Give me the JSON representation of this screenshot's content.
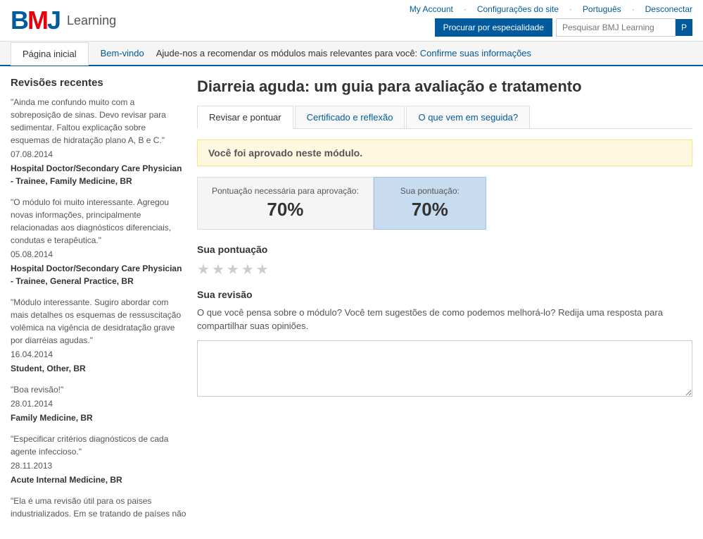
{
  "logo": {
    "bmj": "BMJ",
    "learning": "Learning"
  },
  "topnav": {
    "my_account": "My Account",
    "configuracoes": "Configurações do site",
    "portugues": "Português",
    "desconectar": "Desconectar",
    "search_placeholder": "Pesquisar BMJ Learning",
    "search_button": "P",
    "specialty_button": "Procurar por especialidade"
  },
  "tabs": {
    "home": "Página inicial",
    "welcome_prefix": "Bem-vindo",
    "welcome_message": "Ajude-nos a recomendar os módulos mais relevantes para você:",
    "confirm_link": "Confirme suas informações"
  },
  "sidebar": {
    "title": "Revisões recentes",
    "reviews": [
      {
        "quote": "\"Ainda me confundo muito com a sobreposição de sinas. Devo revisar para sedimentar. Faltou explicação sobre esquemas de hidratação plano A, B e C.\"",
        "date": "07.08.2014",
        "author": "Hospital Doctor/Secondary Care Physician - Trainee, Family Medicine, BR"
      },
      {
        "quote": "\"O módulo foi muito interessante. Agregou novas informações, principalmente relacionadas aos diagnósticos diferenciais, condutas e terapêutica.\"",
        "date": "05.08.2014",
        "author": "Hospital Doctor/Secondary Care Physician - Trainee, General Practice, BR"
      },
      {
        "quote": "\"Módulo interessante. Sugiro abordar com mais detalhes os esquemas de ressuscitação volêmica na vigência de desidratação grave por diarréias agudas.\"",
        "date": "16.04.2014",
        "author": "Student, Other, BR"
      },
      {
        "quote": "\"Boa revisão!\"",
        "date": "28.01.2014",
        "author": "Family Medicine, BR"
      },
      {
        "quote": "\"Especificar critérios diagnósticos de cada agente infeccioso.\"",
        "date": "28.11.2013",
        "author": "Acute Internal Medicine, BR"
      },
      {
        "quote": "\"Ela é uma revisão útil para os paises industrializados. Em se tratando de países não"
      }
    ]
  },
  "module": {
    "title": "Diarreia aguda: um guia para avaliação e tratamento",
    "tabs": {
      "review_score": "Revisar e pontuar",
      "certificate": "Certificado e reflexão",
      "next": "O que vem em seguida?"
    },
    "approval_banner": "Você foi aprovado neste módulo.",
    "score": {
      "required_label": "Pontuação necessária para aprovação:",
      "required_value": "70%",
      "achieved_label": "Sua pontuação:",
      "achieved_value": "70%"
    },
    "your_score_section": "Sua pontuação",
    "your_review_section": "Sua revisão",
    "review_description": "O que você pensa sobre o módulo? Você tem sugestões de como podemos melhorá-lo? Redija uma resposta para compartilhar suas opiniões.",
    "stars": [
      "★",
      "★",
      "★",
      "★",
      "★"
    ]
  }
}
